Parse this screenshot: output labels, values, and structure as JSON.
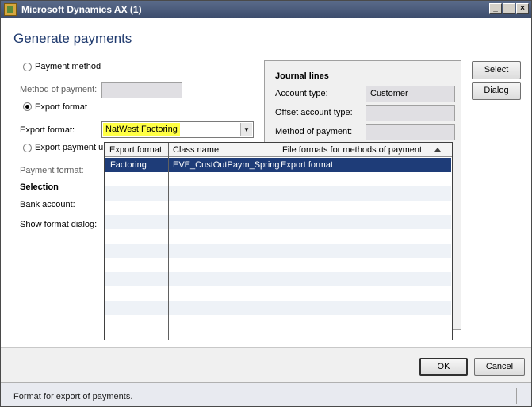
{
  "window": {
    "title": "Microsoft Dynamics AX (1)",
    "controls": {
      "minimize": "_",
      "maximize": "□",
      "close": "×"
    }
  },
  "dialog": {
    "heading": "Generate payments"
  },
  "left": {
    "payment_method_radio": "Payment method",
    "method_of_payment_label": "Method of payment:",
    "export_format_radio": "Export format",
    "export_format_label": "Export format:",
    "export_format_value": "NatWest Factoring",
    "export_payment_radio": "Export payment u",
    "payment_format_label": "Payment format:",
    "selection_title": "Selection",
    "bank_account_label": "Bank account:",
    "show_format_dialog_label": "Show format dialog:"
  },
  "journal": {
    "title": "Journal lines",
    "account_type_label": "Account type:",
    "account_type_value": "Customer",
    "offset_account_type_label": "Offset account type:",
    "method_of_payment_label": "Method of payment:"
  },
  "side_buttons": {
    "select": "Select",
    "dialog": "Dialog"
  },
  "lookup": {
    "columns": [
      "Export format",
      "Class name",
      "File formats for methods of payment"
    ],
    "rows": [
      {
        "export_format": "Factoring",
        "class_name": "EVE_CustOutPaym_Spring",
        "file_format": "Export format"
      }
    ]
  },
  "footer": {
    "ok": "OK",
    "cancel": "Cancel"
  },
  "status": {
    "text": "Format for export of payments."
  }
}
